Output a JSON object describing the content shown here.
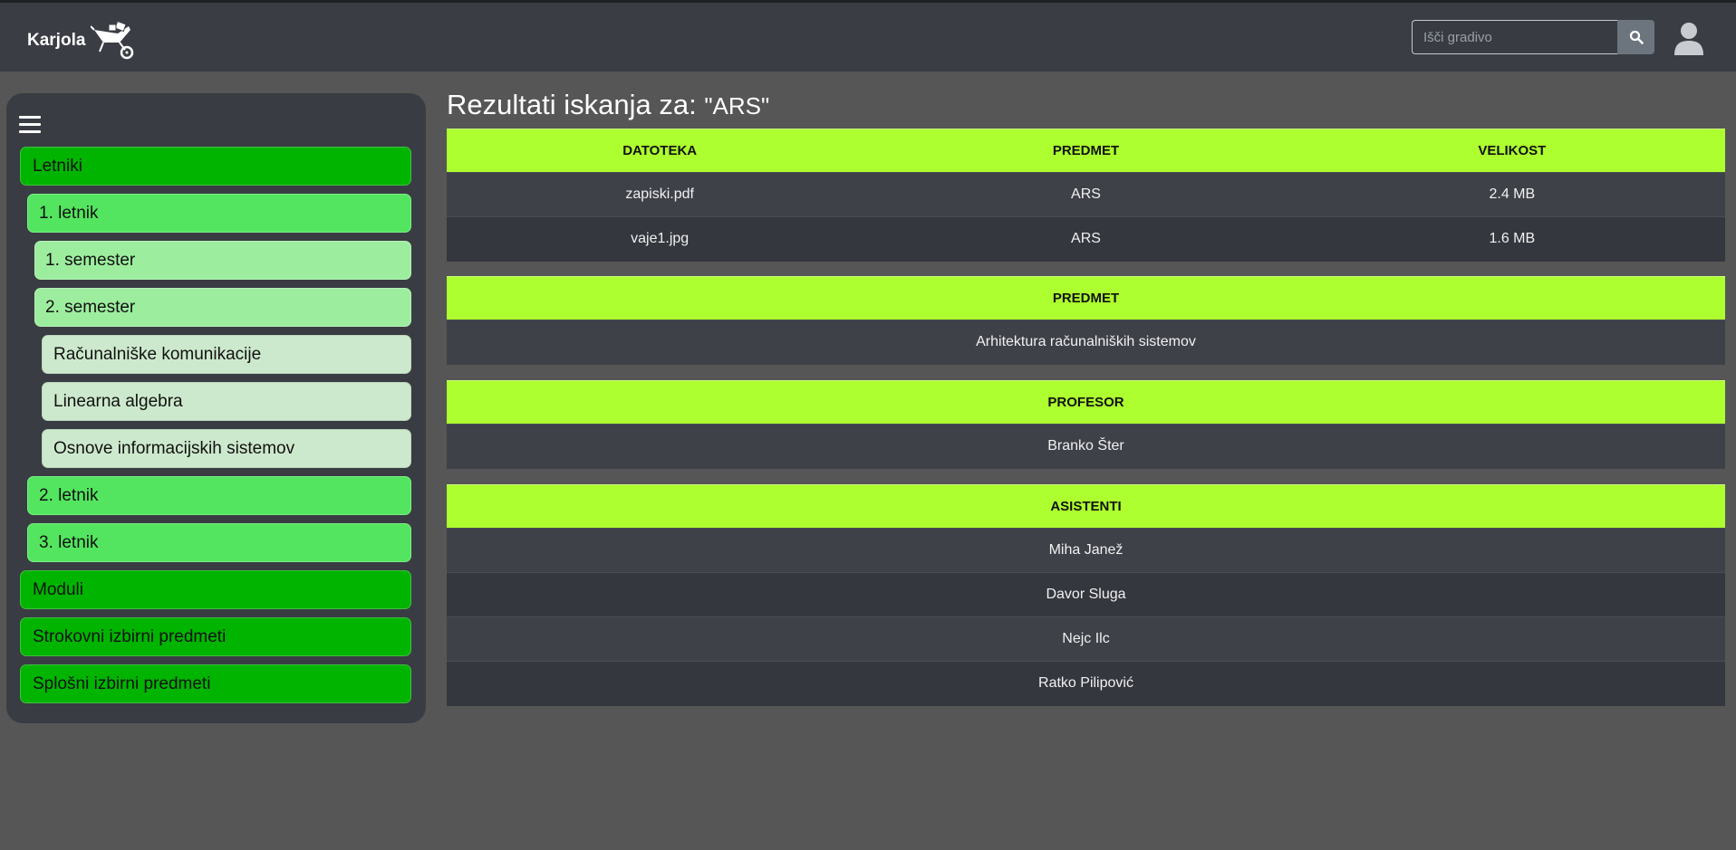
{
  "header": {
    "brand": "Karjola",
    "search_placeholder": "Išči gradivo"
  },
  "sidebar": {
    "items": [
      {
        "label": "Letniki",
        "level": 0
      },
      {
        "label": "1. letnik",
        "level": 1
      },
      {
        "label": "1. semester",
        "level": 2
      },
      {
        "label": "2. semester",
        "level": 2
      },
      {
        "label": "Računalniške komunikacije",
        "level": 3
      },
      {
        "label": "Linearna algebra",
        "level": 3
      },
      {
        "label": "Osnove informacijskih sistemov",
        "level": 3
      },
      {
        "label": "2. letnik",
        "level": 1
      },
      {
        "label": "3. letnik",
        "level": 1
      },
      {
        "label": "Moduli",
        "level": 0
      },
      {
        "label": "Strokovni izbirni predmeti",
        "level": 0
      },
      {
        "label": "Splošni izbirni predmeti",
        "level": 0
      }
    ]
  },
  "main": {
    "title_prefix": "Rezultati iskanja za:",
    "query": "\"ARS\"",
    "files_table": {
      "headers": [
        "DATOTEKA",
        "PREDMET",
        "VELIKOST"
      ],
      "rows": [
        [
          "zapiski.pdf",
          "ARS",
          "2.4 MB"
        ],
        [
          "vaje1.jpg",
          "ARS",
          "1.6 MB"
        ]
      ]
    },
    "subject_table": {
      "header": "PREDMET",
      "rows": [
        "Arhitektura računalniških sistemov"
      ]
    },
    "professor_table": {
      "header": "PROFESOR",
      "rows": [
        "Branko Šter"
      ]
    },
    "assistants_table": {
      "header": "ASISTENTI",
      "rows": [
        "Miha Janež",
        "Davor Sluga",
        "Nejc Ilc",
        "Ratko Pilipović"
      ]
    }
  },
  "colors": {
    "navbar": "#3a3d44",
    "background": "#565656",
    "table_header": "#adff2f",
    "menu_level0": "#00b400",
    "menu_level1": "#53e55f",
    "menu_level2": "#9ded9f",
    "menu_level3": "#cde9cd"
  },
  "icons": {
    "logo": "wheelbarrow-logo",
    "search": "search-icon",
    "user": "user-icon",
    "menu": "hamburger-icon"
  }
}
